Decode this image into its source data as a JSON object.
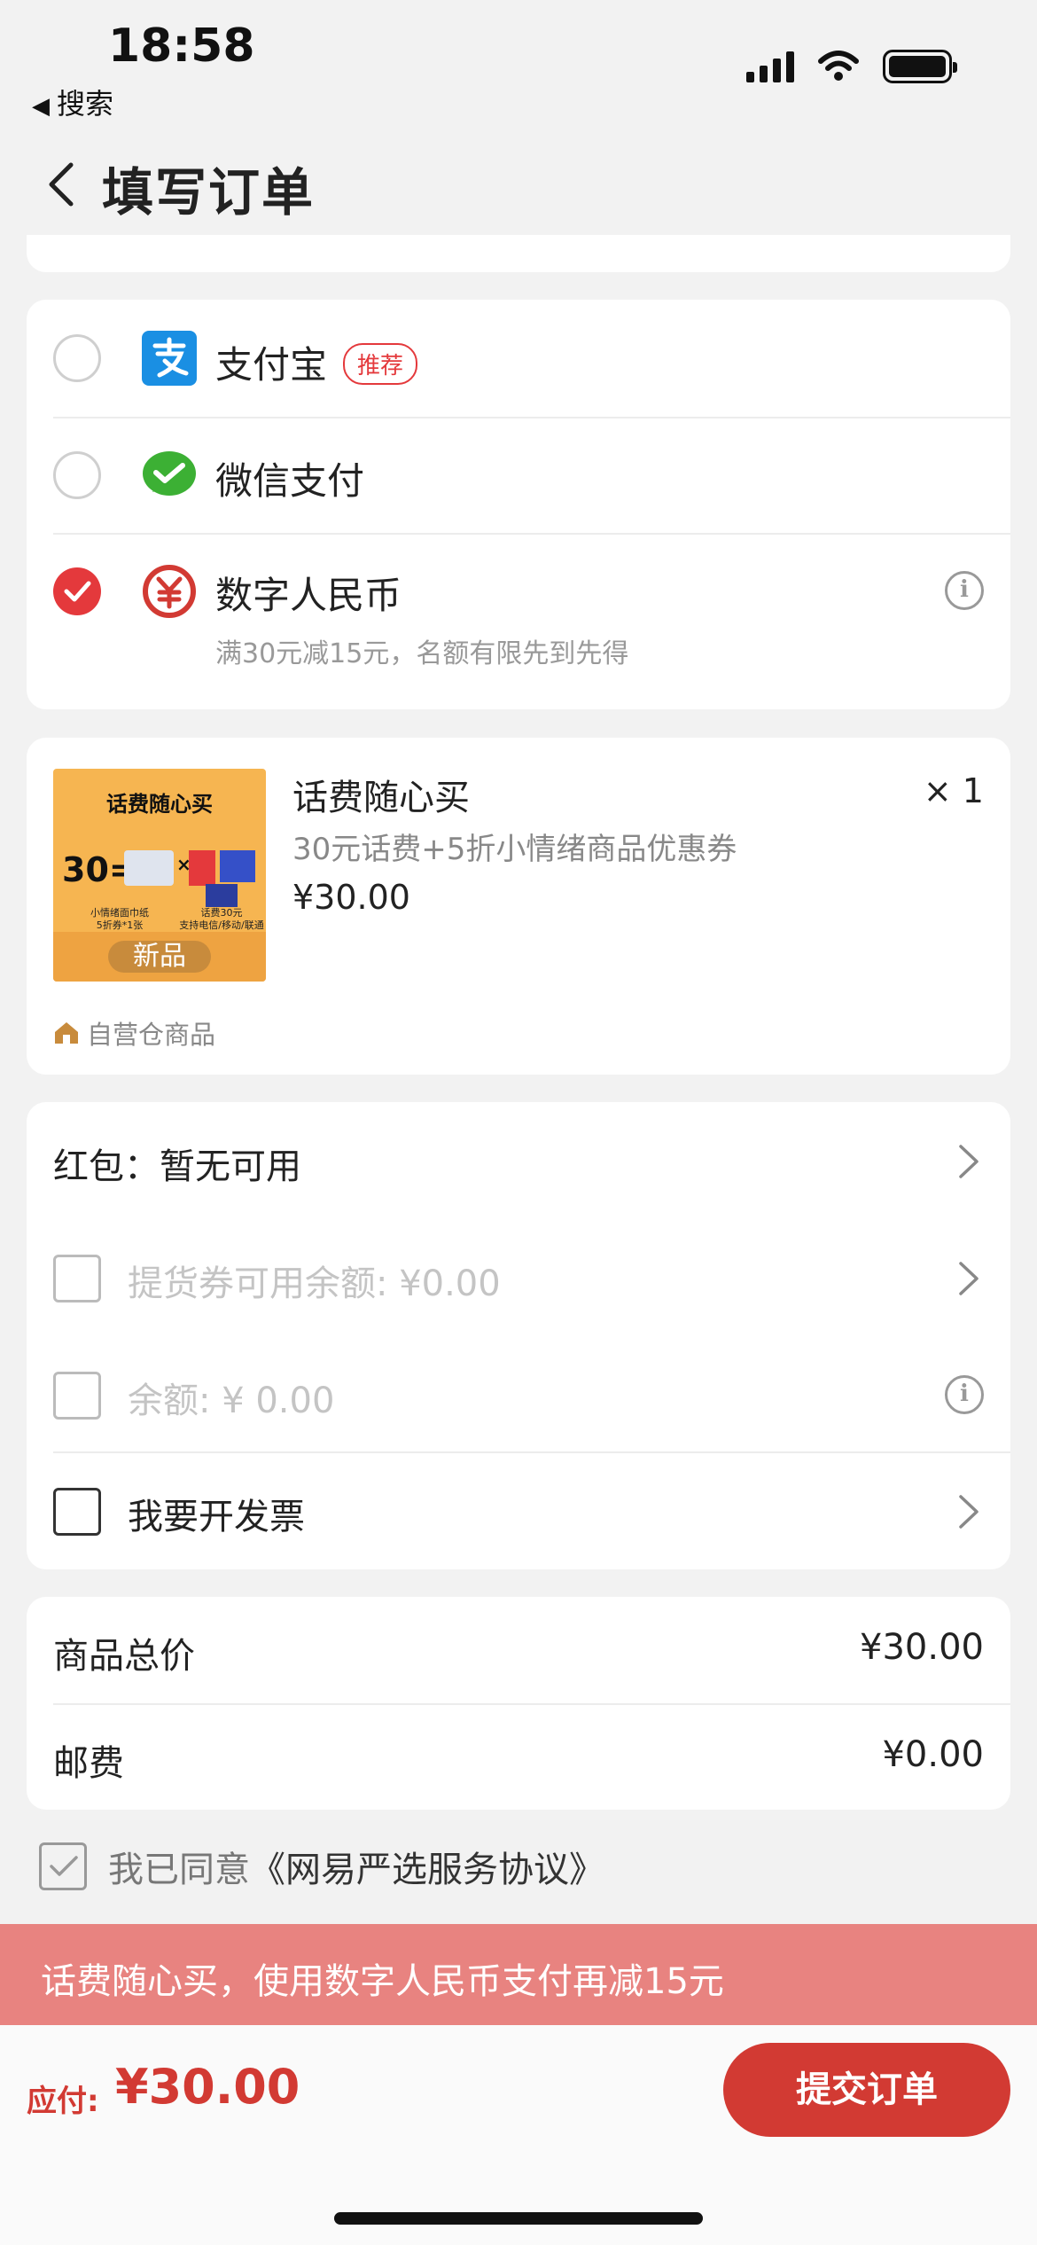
{
  "status_bar": {
    "time": "18:58",
    "back_app": "搜索"
  },
  "header": {
    "title": "填写订单"
  },
  "payment": {
    "methods": [
      {
        "label": "支付宝",
        "tag": "推荐",
        "selected": false,
        "icon": "alipay-icon"
      },
      {
        "label": "微信支付",
        "selected": false,
        "icon": "wechat-pay-icon"
      },
      {
        "label": "数字人民币",
        "subtitle": "满30元减15元，名额有限先到先得",
        "selected": true,
        "icon": "digital-rmb-icon"
      }
    ]
  },
  "product": {
    "image_title": "话费随心买",
    "image_price": "30=",
    "image_note_left": "小情绪面巾纸\n5折券*1张",
    "image_note_right": "话费30元\n支持电信/移动/联通",
    "image_badge": "新品",
    "name": "话费随心买",
    "quantity": "× 1",
    "description": "30元话费+5折小情绪商品优惠券",
    "price": "¥30.00",
    "warehouse": "自营仓商品"
  },
  "options": {
    "red_packet": "红包：暂无可用",
    "voucher": "提货券可用余额: ¥0.00",
    "balance": "余额: ¥ 0.00",
    "invoice": "我要开发票"
  },
  "price_summary": {
    "items": [
      {
        "label": "商品总价",
        "value": "¥30.00"
      },
      {
        "label": "邮费",
        "value": "¥0.00"
      }
    ]
  },
  "agreement": {
    "prefix": "我已同意",
    "link": "《网易严选服务协议》",
    "checked": true
  },
  "promo": {
    "text": "话费随心买，使用数字人民币支付再减15元"
  },
  "bottom_bar": {
    "due_label": "应付:",
    "due_value": "¥30.00",
    "submit_label": "提交订单"
  },
  "colors": {
    "accent": "#d23a33",
    "alipay": "#1a8fe3",
    "wechat": "#3cb034",
    "promo_bg": "#e88380"
  }
}
